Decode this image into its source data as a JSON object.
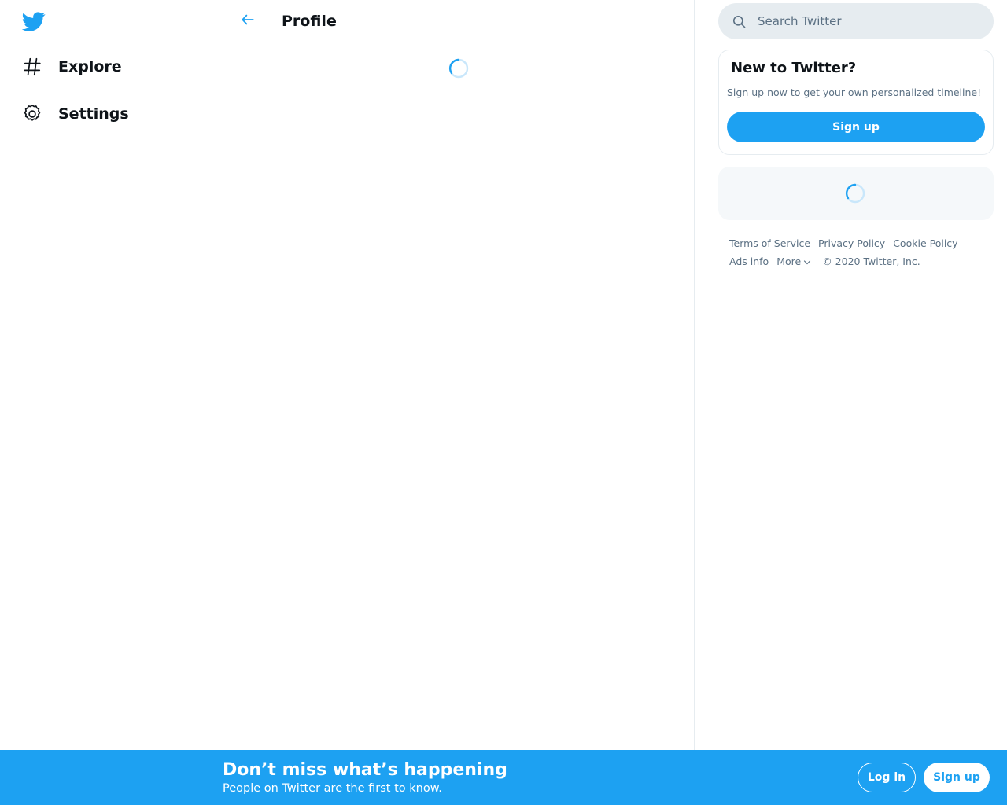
{
  "nav": {
    "logo_icon": "twitter-bird-icon",
    "items": [
      {
        "label": "Explore",
        "icon": "hashtag-icon"
      },
      {
        "label": "Settings",
        "icon": "gear-icon"
      }
    ]
  },
  "main": {
    "back_icon": "arrow-left-icon",
    "title": "Profile",
    "loading": true
  },
  "search": {
    "placeholder": "Search Twitter",
    "value": "",
    "icon": "search-icon"
  },
  "signup_card": {
    "title": "New to Twitter?",
    "description": "Sign up now to get your own personalized timeline!",
    "button_label": "Sign up"
  },
  "footer": {
    "links_row1": [
      "Terms of Service",
      "Privacy Policy",
      "Cookie Policy"
    ],
    "ads_info": "Ads info",
    "more": "More",
    "copyright": "© 2020 Twitter, Inc."
  },
  "banner": {
    "title": "Don’t miss what’s happening",
    "subtitle": "People on Twitter are the first to know.",
    "login_label": "Log in",
    "signup_label": "Sign up"
  },
  "colors": {
    "accent": "#1da1f2",
    "border": "#e6ecf0",
    "secondary_text": "#5b7083",
    "primary_text": "#0f1419"
  }
}
